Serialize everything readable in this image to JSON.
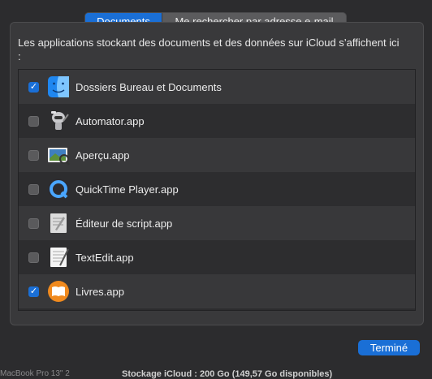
{
  "tabs": [
    {
      "label": "Documents",
      "active": true
    },
    {
      "label": "Me rechercher par adresse e-mail",
      "active": false
    }
  ],
  "description": "Les applications stockant des documents et des données sur iCloud s’affichent ici :",
  "apps": [
    {
      "label": "Dossiers Bureau et Documents",
      "checked": true,
      "icon": "finder-icon"
    },
    {
      "label": "Automator.app",
      "checked": false,
      "icon": "automator-icon"
    },
    {
      "label": "Aperçu.app",
      "checked": false,
      "icon": "preview-icon"
    },
    {
      "label": "QuickTime Player.app",
      "checked": false,
      "icon": "quicktime-icon"
    },
    {
      "label": "Éditeur de script.app",
      "checked": false,
      "icon": "script-editor-icon"
    },
    {
      "label": "TextEdit.app",
      "checked": false,
      "icon": "textedit-icon"
    },
    {
      "label": "Livres.app",
      "checked": true,
      "icon": "books-icon"
    }
  ],
  "done_label": "Terminé",
  "footer": {
    "left": "MacBook Pro 13\" 2",
    "storage": "Stockage iCloud : 200 Go (149,57 Go disponibles)"
  },
  "colors": {
    "accent": "#1a6fd6",
    "background": "#2c2c2e"
  }
}
